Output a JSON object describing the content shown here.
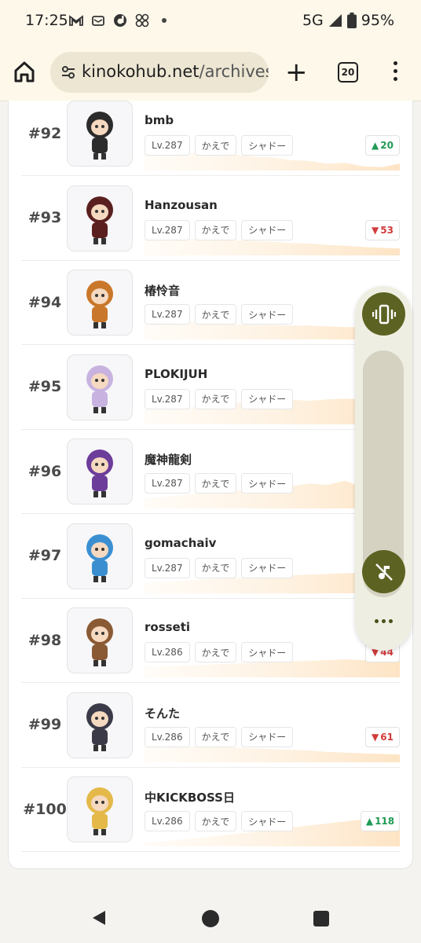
{
  "status_bar": {
    "time": "17:25",
    "notification_icons": [
      "gmail-icon",
      "news-icon",
      "d-app-icon",
      "pinwheel-icon",
      "dot-icon"
    ],
    "network": "5G",
    "battery": "95%"
  },
  "toolbar": {
    "url_domain": "kinokohub.net",
    "url_path": "/archives/r",
    "tab_count": "20"
  },
  "rows": [
    {
      "rank": "#92",
      "name": "bmb",
      "level": "Lv.287",
      "world": "かえで",
      "job": "シャドー",
      "delta": "20",
      "dir": "up",
      "avatar_color": "#2c2c2c",
      "spark": [
        0.55,
        0.52,
        0.5,
        0.5,
        0.42,
        0.46,
        0.4,
        0.38,
        0.3,
        0.28,
        0.2,
        0.22,
        0.12,
        0.1,
        0.2
      ]
    },
    {
      "rank": "#93",
      "name": "Hanzousan",
      "level": "Lv.287",
      "world": "かえで",
      "job": "シャドー",
      "delta": "53",
      "dir": "down",
      "avatar_color": "#5a1f1f",
      "spark": [
        0.5,
        0.5,
        0.48,
        0.5,
        0.45,
        0.44,
        0.42,
        0.4,
        0.36,
        0.34,
        0.3,
        0.28,
        0.24,
        0.22,
        0.2
      ]
    },
    {
      "rank": "#94",
      "name": "椿怜音",
      "level": "Lv.287",
      "world": "かえで",
      "job": "シャドー",
      "delta": "",
      "dir": "",
      "avatar_color": "#c9772a",
      "spark": [
        0.55,
        0.52,
        0.52,
        0.5,
        0.46,
        0.44,
        0.42,
        0.42,
        0.4,
        0.4,
        0.38,
        0.36,
        0.36,
        0.34,
        0.3
      ]
    },
    {
      "rank": "#95",
      "name": "PLOKIJUH",
      "level": "Lv.287",
      "world": "かえで",
      "job": "シャドー",
      "delta": "",
      "dir": "",
      "avatar_color": "#c8b3e0",
      "spark": [
        0.4,
        0.42,
        0.5,
        0.52,
        0.6,
        0.62,
        0.66,
        0.7,
        0.72,
        0.68,
        0.72,
        0.74,
        0.72,
        0.74,
        0.72
      ]
    },
    {
      "rank": "#96",
      "name": "魔神龍剣",
      "level": "Lv.287",
      "world": "かえで",
      "job": "シャドー",
      "delta": "",
      "dir": "",
      "avatar_color": "#6d3d9a",
      "spark": [
        0.3,
        0.32,
        0.38,
        0.45,
        0.55,
        0.5,
        0.62,
        0.7,
        0.64,
        0.72,
        0.68,
        0.8,
        0.6,
        0.78,
        0.76
      ]
    },
    {
      "rank": "#97",
      "name": "gomachaiv",
      "level": "Lv.287",
      "world": "かえで",
      "job": "シャドー",
      "delta": "",
      "dir": "",
      "avatar_color": "#3b8fd1",
      "spark": [
        0.3,
        0.32,
        0.36,
        0.4,
        0.42,
        0.44,
        0.46,
        0.5,
        0.52,
        0.54,
        0.56,
        0.58,
        0.6,
        0.62,
        0.64
      ]
    },
    {
      "rank": "#98",
      "name": "rosseti",
      "level": "Lv.286",
      "world": "かえで",
      "job": "シャドー",
      "delta": "44",
      "dir": "down",
      "avatar_color": "#8a5a34",
      "spark": [
        0.3,
        0.32,
        0.34,
        0.36,
        0.38,
        0.4,
        0.42,
        0.44,
        0.46,
        0.48,
        0.5,
        0.52,
        0.5,
        0.52,
        0.54
      ]
    },
    {
      "rank": "#99",
      "name": "そんた",
      "level": "Lv.286",
      "world": "かえで",
      "job": "シャドー",
      "delta": "61",
      "dir": "down",
      "avatar_color": "#3a3a48",
      "spark": [
        0.55,
        0.5,
        0.48,
        0.46,
        0.44,
        0.42,
        0.4,
        0.38,
        0.36,
        0.34,
        0.3,
        0.28,
        0.26,
        0.24,
        0.22
      ]
    },
    {
      "rank": "#100",
      "name": "中KICKBOSS日",
      "level": "Lv.286",
      "world": "かえで",
      "job": "シャドー",
      "delta": "118",
      "dir": "up",
      "avatar_color": "#e4b94a",
      "spark": [
        0.1,
        0.14,
        0.2,
        0.24,
        0.3,
        0.36,
        0.42,
        0.48,
        0.54,
        0.6,
        0.66,
        0.72,
        0.78,
        0.84,
        0.96
      ]
    }
  ],
  "volume_panel": {
    "vibrate_icon": "vibrate-icon",
    "mute_icon": "music-off-icon",
    "more_icon": "more-horiz-icon"
  },
  "colors": {
    "accent_olive": "#5c6221",
    "spark_fill": "#fde4c4",
    "up": "#1f9a55",
    "down": "#d23b3b"
  }
}
